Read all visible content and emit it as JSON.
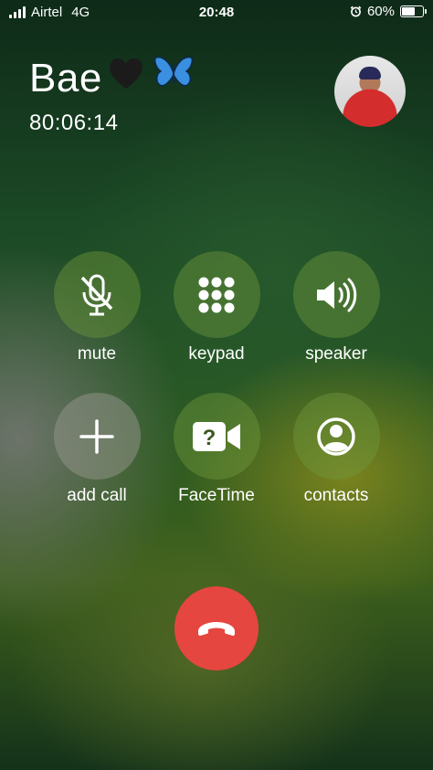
{
  "status_bar": {
    "carrier": "Airtel",
    "network": "4G",
    "time": "20:48",
    "battery_percent": "60%",
    "battery_level": 0.6,
    "alarm_icon": "alarm-clock-icon"
  },
  "call": {
    "caller_name": "Bae",
    "name_emoji_1": "🖤",
    "name_emoji_2": "🦋",
    "duration": "80:06:14"
  },
  "buttons": {
    "mute": {
      "label": "mute",
      "icon": "mic-slash-icon"
    },
    "keypad": {
      "label": "keypad",
      "icon": "keypad-icon"
    },
    "speaker": {
      "label": "speaker",
      "icon": "speaker-icon"
    },
    "add_call": {
      "label": "add call",
      "icon": "plus-icon"
    },
    "facetime": {
      "label": "FaceTime",
      "icon": "video-question-icon"
    },
    "contacts": {
      "label": "contacts",
      "icon": "person-circle-icon"
    }
  },
  "end_call": {
    "icon": "phone-down-icon",
    "color": "#e5463f"
  }
}
